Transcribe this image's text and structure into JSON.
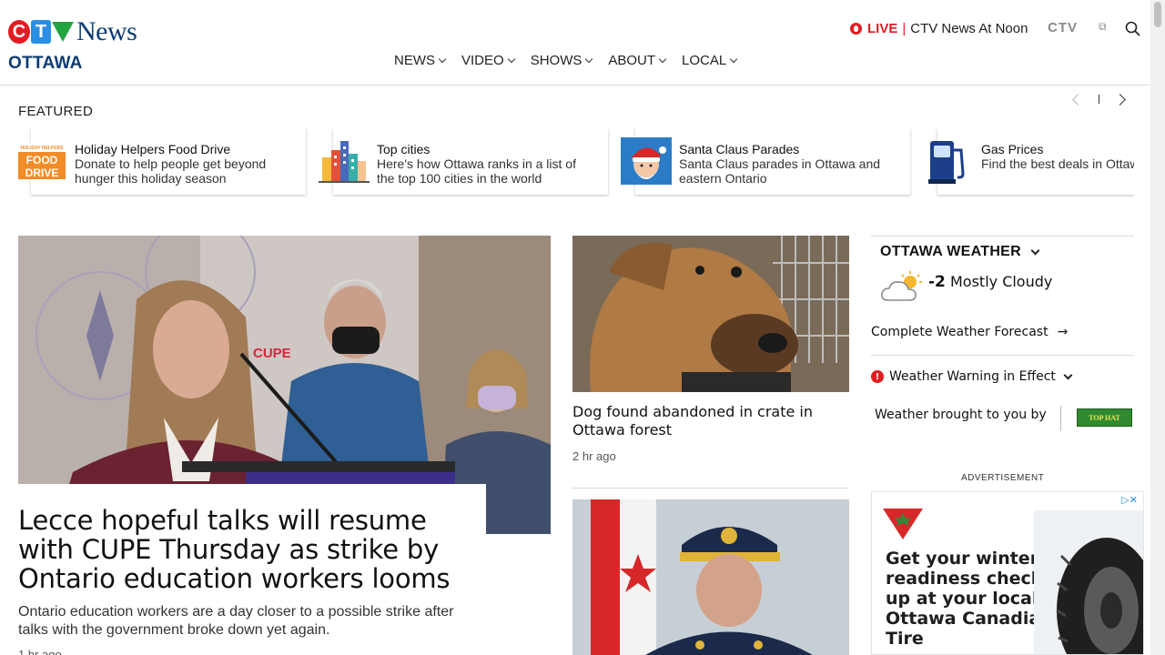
{
  "header": {
    "logo": {
      "c": "C",
      "t": "T",
      "news": "News"
    },
    "city": "OTTAWA",
    "live": {
      "label": "LIVE",
      "separator": "|",
      "program": "CTV News At Noon"
    },
    "ctv_link": "CTV",
    "external_icon": "external-link-icon",
    "search_icon": "search-icon"
  },
  "nav": [
    "NEWS",
    "VIDEO",
    "SHOWS",
    "ABOUT",
    "LOCAL"
  ],
  "featured": {
    "label": "FEATURED",
    "cards": [
      {
        "title": "Holiday Helpers Food Drive",
        "desc": "Donate to help people get beyond hunger this holiday season",
        "thumb": {
          "top": "HOLIDAY HELPERS",
          "l1": "FOOD",
          "l2": "DRIVE"
        }
      },
      {
        "title": "Top cities",
        "desc": "Here's how Ottawa ranks in a list of the top 100 cities in the world"
      },
      {
        "title": "Santa Claus Parades",
        "desc": "Santa Claus parades in Ottawa and eastern Ontario"
      },
      {
        "title": "Gas Prices",
        "desc": "Find the best deals in Ottawa as prices fluctuate"
      }
    ]
  },
  "lead": {
    "headline": "Lecce hopeful talks will resume with CUPE Thursday as strike by Ontario education workers looms",
    "dek": "Ontario education workers are a day closer to a possible strike after talks with the government broke down yet again.",
    "time": "1 hr ago",
    "img_text": "CUPE"
  },
  "middle": {
    "story1": {
      "headline": "Dog found abandoned in crate in Ottawa forest",
      "time": "2 hr ago"
    }
  },
  "weather": {
    "title": "OTTAWA WEATHER",
    "temp": "-2",
    "condition": "Mostly Cloudy",
    "forecast_link": "Complete Weather Forecast",
    "forecast_arrow": "→",
    "warning": "Weather Warning in Effect",
    "warning_mark": "!",
    "sponsor_text": "Weather brought to you by",
    "sponsor_logo": "TOP HAT"
  },
  "ad": {
    "label": "ADVERTISEMENT",
    "choices": "▷✕",
    "text": "Get your winter readiness check-up at your local Ottawa Canadian Tire"
  },
  "colors": {
    "brand_red": "#e21b22",
    "brand_navy": "#0c3c74"
  }
}
